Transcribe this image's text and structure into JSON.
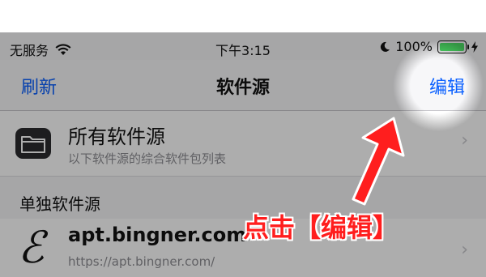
{
  "status_bar": {
    "carrier": "无服务",
    "time": "下午3:15",
    "battery": "100%",
    "icons": [
      "wifi-icon",
      "moon-icon",
      "battery-icon",
      "charging-icon"
    ]
  },
  "nav": {
    "left_label": "刷新",
    "title": "软件源",
    "right_label": "编辑"
  },
  "all_sources": {
    "title": "所有软件源",
    "subtitle": "以下软件源的综合软件包列表",
    "icon": "folder-icon"
  },
  "section_header": "单独软件源",
  "sources": [
    {
      "name": "apt.bingner.com",
      "url": "https://apt.bingner.com/",
      "icon": "elucubratus-icon"
    }
  ],
  "annotation": {
    "caption": "点击【编辑】",
    "color": "#ff1e1e"
  },
  "colors": {
    "accent": "#0a60ff",
    "battery": "#4cd964"
  }
}
